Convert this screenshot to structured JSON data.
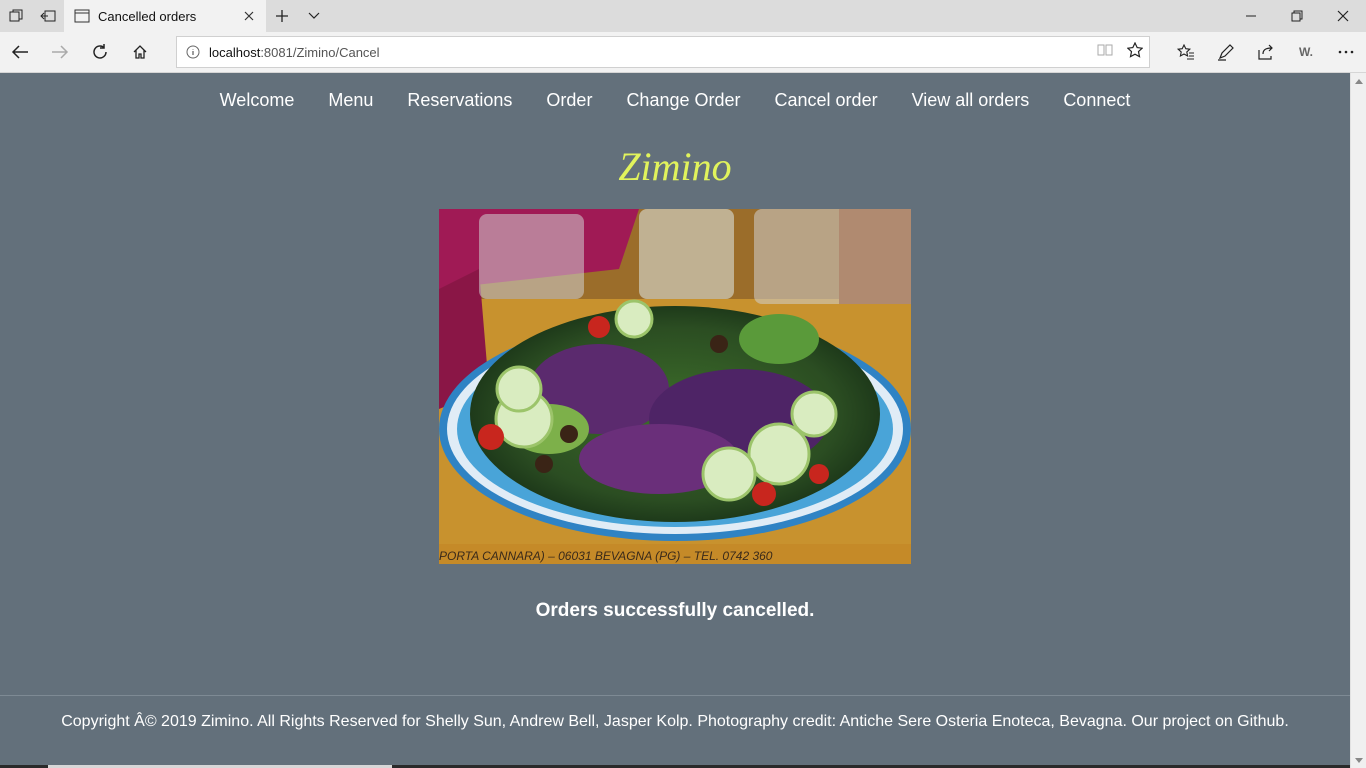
{
  "browser": {
    "tab_title": "Cancelled orders",
    "url_host": "localhost",
    "url_rest": ":8081/Zimino/Cancel",
    "extension_letter": "W."
  },
  "site": {
    "nav": [
      "Welcome",
      "Menu",
      "Reservations",
      "Order",
      "Change Order",
      "Cancel order",
      "View all orders",
      "Connect"
    ],
    "brand": "Zimino",
    "photo_alt": "Salad with red cabbage, cucumber, tomatoes and olives on a blue-rimmed plate",
    "status_message": "Orders successfully cancelled.",
    "footer": "Copyright Â© 2019 Zimino. All Rights Reserved for Shelly Sun, Andrew Bell, Jasper Kolp. Photography credit: Antiche Sere Osteria Enoteca, Bevagna. Our project on Github.",
    "placemat_text": "PORTA CANNARA) – 06031 BEVAGNA (PG) – TEL. 0742 360"
  },
  "colors": {
    "page_bg": "#63707b",
    "brand": "#e1f35c",
    "text": "#ffffff"
  }
}
